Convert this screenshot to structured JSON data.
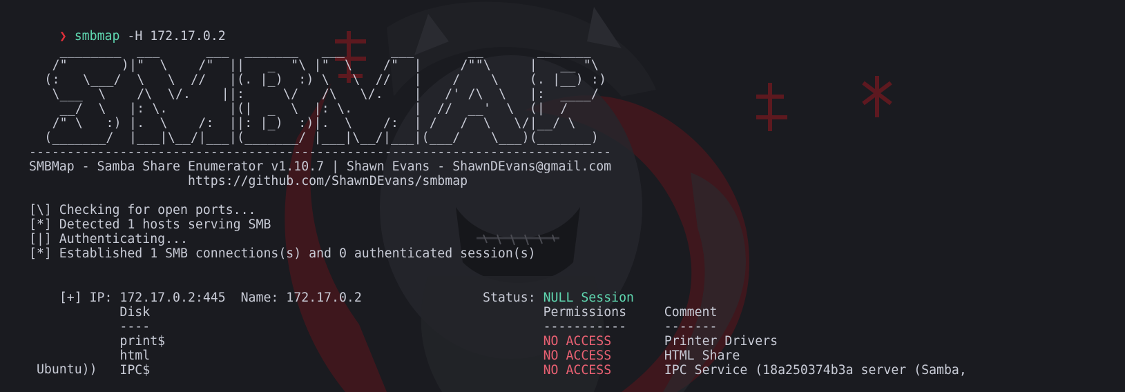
{
  "colors": {
    "background": "#1a1b20",
    "text": "#c8cbd6",
    "prompt": "#e0303a",
    "command": "#5fd7b0",
    "null_session": "#5fd7b0",
    "no_access": "#ea6173",
    "wallpaper_accent": "#7a1820"
  },
  "icons": {
    "prompt": "chevron-right-icon"
  },
  "prompt": {
    "symbol": "❯",
    "command": "smbmap",
    "args": " -H 172.17.0.2"
  },
  "banner": [
    "    ________  ___      ___  _______   ___      ___       __       _______",
    "   /\"       )|\"  \\    /\"  ||   _  \"\\ |\"  \\    /\"  |     /\"\"\\     |   __ \"\\",
    "  (:   \\___/  \\   \\  //   |(. |_)  :) \\   \\  //   |    /    \\    (. |__) :)",
    "   \\___  \\    /\\  \\/.    ||:     \\/   /\\   \\/.    |   /' /\\  \\   |:  ____/",
    "    __/  \\   |: \\.        |(|  _  \\  |: \\.        |  //  __'  \\  (|  /",
    "   /\" \\   :) |.  \\    /:  ||: |_)  :)|.  \\    /:  | /   /  \\   \\/|__/ \\",
    "  (_______/  |___|\\__/|___|(_______/ |___|\\__/|___|(___/    \\___)(_______)"
  ],
  "divider": "-----------------------------------------------------------------------------",
  "info": {
    "title": "SMBMap - Samba Share Enumerator v1.10.7 | Shawn Evans - ShawnDEvans@gmail.com",
    "url": "                     https://github.com/ShawnDEvans/smbmap"
  },
  "progress": [
    "[\\] Checking for open ports...",
    "[*] Detected 1 hosts serving SMB",
    "[|] Authenticating...",
    "[*] Established 1 SMB connections(s) and 0 authenticated session(s)"
  ],
  "host": {
    "line_prefix": "[+] IP: 172.17.0.2:445  Name: 172.17.0.2                Status: ",
    "status": "NULL Session"
  },
  "shares": {
    "header_disk": "        Disk                                                    ",
    "header_permissions": "Permissions",
    "header_comment": "     Comment",
    "underline_disk": "        ----                                                    ",
    "underline_permissions": "-----------",
    "underline_comment": "     -------",
    "rows": [
      {
        "pre": "        print$                                                  ",
        "permission": "NO ACCESS",
        "comment": "       Printer Drivers"
      },
      {
        "pre": "        html                                                    ",
        "permission": "NO ACCESS",
        "comment": "       HTML Share"
      },
      {
        "pre": "        IPC$                                                    ",
        "permission": "NO ACCESS",
        "comment": "       IPC Service (18a250374b3a server (Samba,"
      }
    ],
    "wrap": " Ubuntu))"
  }
}
